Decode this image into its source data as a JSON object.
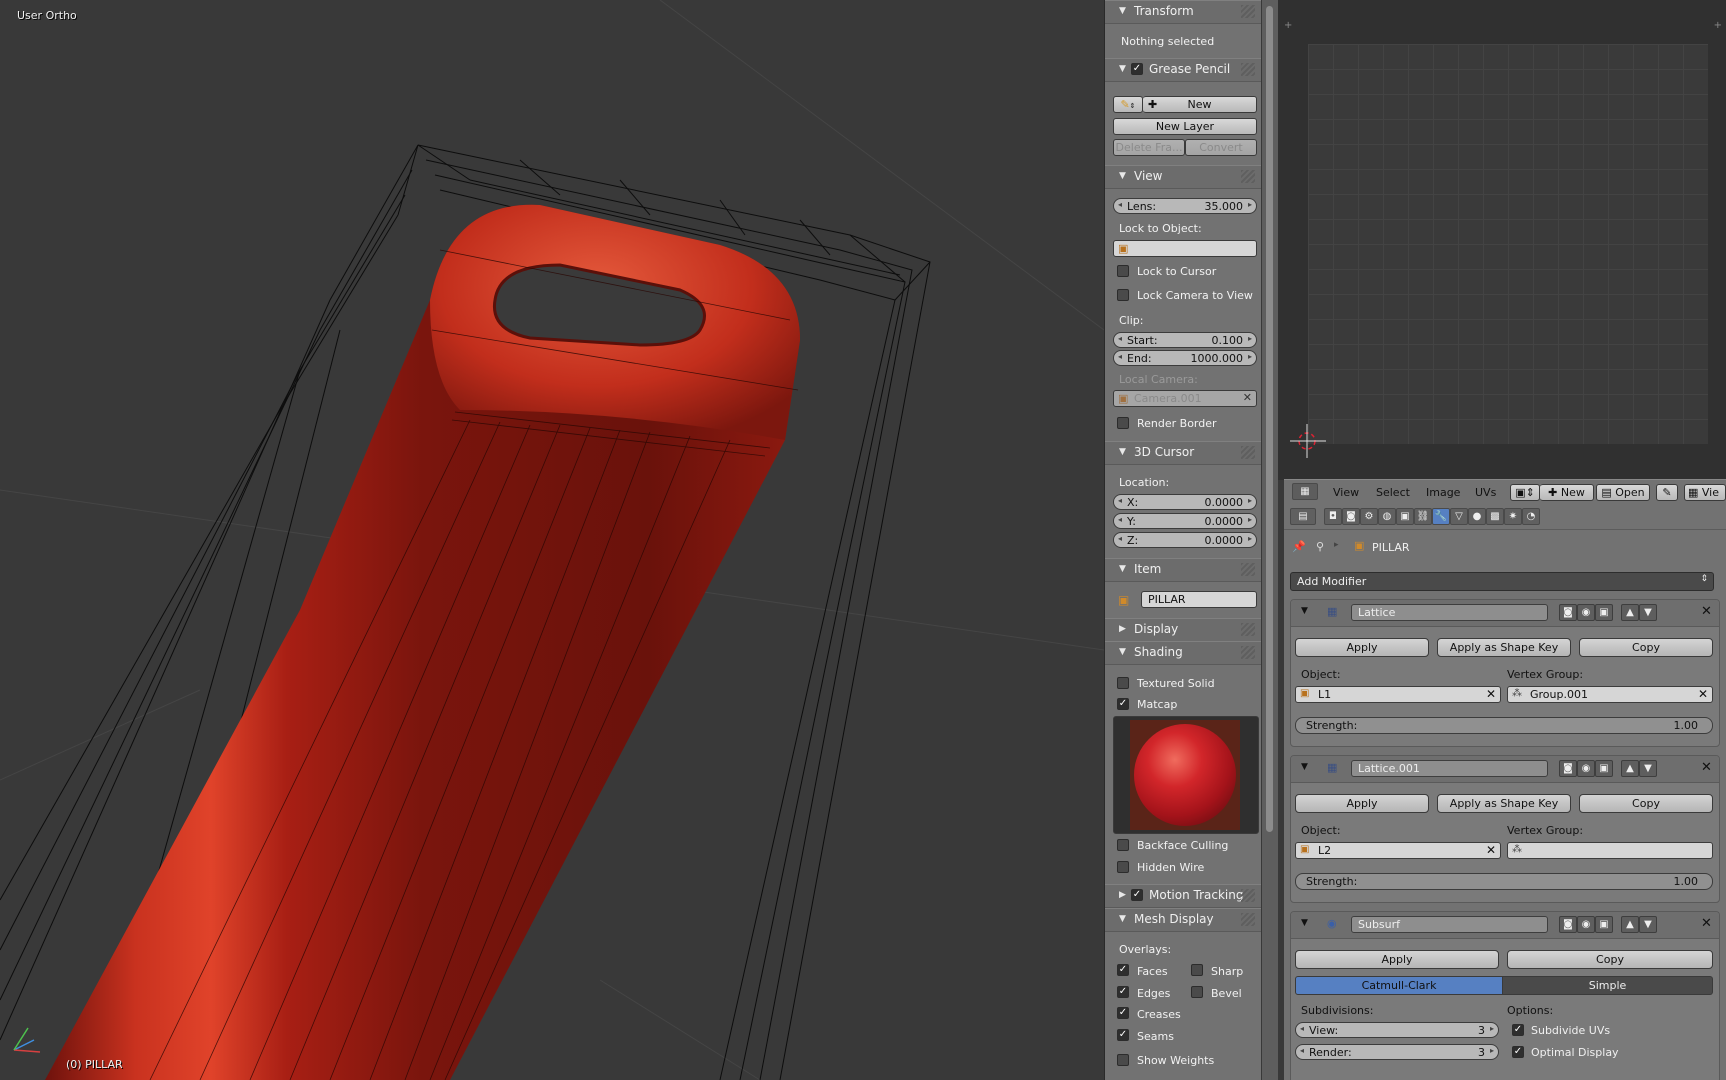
{
  "viewport": {
    "view_name": "User Ortho",
    "object_label": "(0) PILLAR"
  },
  "npanel": {
    "transform": {
      "title": "Transform",
      "status": "Nothing selected"
    },
    "grease_pencil": {
      "title": "Grease Pencil",
      "checked": true,
      "new_label": "New",
      "new_layer_label": "New Layer",
      "delete_frame_label": "Delete Fra...",
      "convert_label": "Convert"
    },
    "view": {
      "title": "View",
      "lens_label": "Lens:",
      "lens_value": "35.000",
      "lock_to_object_label": "Lock to Object:",
      "lock_to_cursor_label": "Lock to Cursor",
      "lock_camera_label": "Lock Camera to View",
      "clip_label": "Clip:",
      "clip_start_label": "Start:",
      "clip_start_value": "0.100",
      "clip_end_label": "End:",
      "clip_end_value": "1000.000",
      "local_camera_label": "Local Camera:",
      "local_camera_value": "Camera.001",
      "render_border_label": "Render Border"
    },
    "cursor": {
      "title": "3D Cursor",
      "location_label": "Location:",
      "x_label": "X:",
      "x_value": "0.0000",
      "y_label": "Y:",
      "y_value": "0.0000",
      "z_label": "Z:",
      "z_value": "0.0000"
    },
    "item": {
      "title": "Item",
      "name": "PILLAR"
    },
    "display": {
      "title": "Display"
    },
    "shading": {
      "title": "Shading",
      "textured_solid_label": "Textured Solid",
      "matcap_label": "Matcap",
      "backface_culling_label": "Backface Culling",
      "hidden_wire_label": "Hidden Wire"
    },
    "motion_tracking": {
      "title": "Motion Tracking"
    },
    "mesh_display": {
      "title": "Mesh Display",
      "overlays_label": "Overlays:",
      "faces_label": "Faces",
      "sharp_label": "Sharp",
      "edges_label": "Edges",
      "bevel_label": "Bevel",
      "creases_label": "Creases",
      "seams_label": "Seams",
      "show_weights_label": "Show Weights"
    }
  },
  "image_editor": {
    "menu": [
      "View",
      "Select",
      "Image",
      "UVs"
    ],
    "new_label": "New",
    "open_label": "Open",
    "view_label": "Vie"
  },
  "properties": {
    "breadcrumb": "PILLAR",
    "add_modifier_label": "Add Modifier",
    "modifiers": [
      {
        "name": "Lattice",
        "apply_label": "Apply",
        "shape_key_label": "Apply as Shape Key",
        "copy_label": "Copy",
        "object_label": "Object:",
        "object_value": "L1",
        "vertex_group_label": "Vertex Group:",
        "vertex_group_value": "Group.001",
        "strength_label": "Strength:",
        "strength_value": "1.00"
      },
      {
        "name": "Lattice.001",
        "apply_label": "Apply",
        "shape_key_label": "Apply as Shape Key",
        "copy_label": "Copy",
        "object_label": "Object:",
        "object_value": "L2",
        "vertex_group_label": "Vertex Group:",
        "vertex_group_value": "",
        "strength_label": "Strength:",
        "strength_value": "1.00"
      },
      {
        "name": "Subsurf",
        "apply_label": "Apply",
        "copy_label": "Copy",
        "mode_a": "Catmull-Clark",
        "mode_b": "Simple",
        "subdivisions_label": "Subdivisions:",
        "view_label": "View:",
        "view_value": "3",
        "render_label": "Render:",
        "render_value": "3",
        "options_label": "Options:",
        "subdivide_uvs_label": "Subdivide UVs",
        "optimal_display_label": "Optimal Display"
      }
    ]
  },
  "colors": {
    "accent": "#5680c2",
    "mesh": "#b8261c",
    "viewport_bg": "#393939",
    "panel_bg": "#727272"
  }
}
